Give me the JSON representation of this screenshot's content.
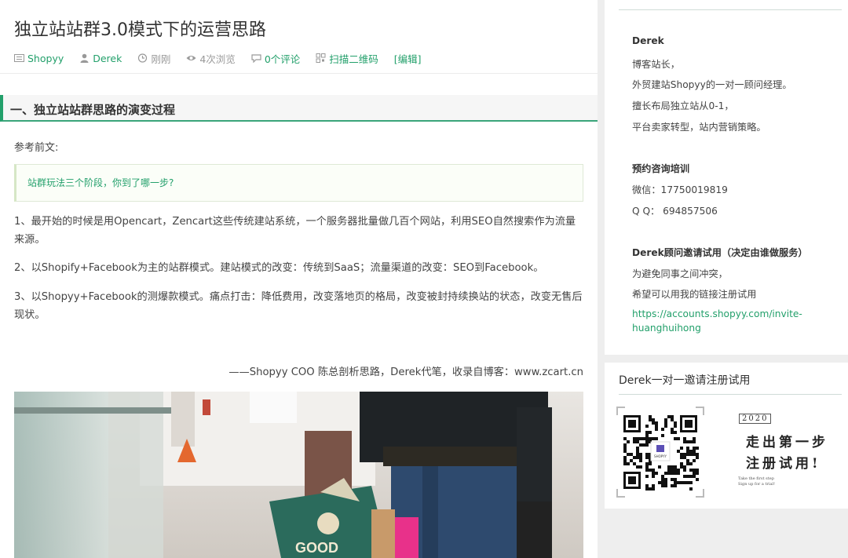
{
  "article": {
    "title": "独立站站群3.0模式下的运营思路",
    "meta": {
      "category": "Shopyy",
      "author": "Derek",
      "time": "刚刚",
      "views": "4次浏览",
      "comments": "0个评论",
      "qrcode": "扫描二维码",
      "edit": "[编辑]"
    },
    "section_heading": "一、独立站站群思路的演变过程",
    "ref_label": "参考前文:",
    "quote_link": "站群玩法三个阶段，你到了哪一步?",
    "paragraphs": [
      "1、最开始的时候是用Opencart，Zencart这些传统建站系统，一个服务器批量做几百个网站，利用SEO自然搜索作为流量来源。",
      "2、以Shopify+Facebook为主的站群模式。建站模式的改变：传统到SaaS；流量渠道的改变：SEO到Facebook。",
      "3、以Shopyy+Facebook的测爆款模式。痛点打击：降低费用，改变落地页的格局，改变被封持续换站的状态，改变无售后现状。"
    ],
    "signature": "——Shopyy COO 陈总剖析思路，Derek代笔，收录自博客：www.zcart.cn"
  },
  "sidebar": {
    "profile": {
      "name": "Derek",
      "line1": "博客站长，",
      "line2": "外贸建站Shopyy的一对一顾问经理。",
      "line3": "擅长布局独立站从0-1，",
      "line4": "平台卖家转型，站内营销策略。"
    },
    "consult": {
      "title": "预约咨询培训",
      "wechat": "微信：17750019819",
      "qq": "Q Q： 694857506"
    },
    "invite": {
      "title": "Derek顾问邀请试用（决定由谁做服务）",
      "line1": "为避免同事之间冲突，",
      "line2": "希望可以用我的链接注册试用",
      "link": "https://accounts.shopyy.com/invite-huanghuihong"
    },
    "widget2": {
      "heading": "Derek一对一邀请注册试用",
      "qr_brand": "SHOPYY",
      "poster_year": "2020",
      "poster_line1": "走出第一步",
      "poster_line2": "注册试用!",
      "poster_en1": "Take the first step",
      "poster_en2": "Sign up for a trial!"
    }
  },
  "colors": {
    "accent": "#23a06b",
    "text": "#444444",
    "page_bg": "#eeeeee"
  }
}
